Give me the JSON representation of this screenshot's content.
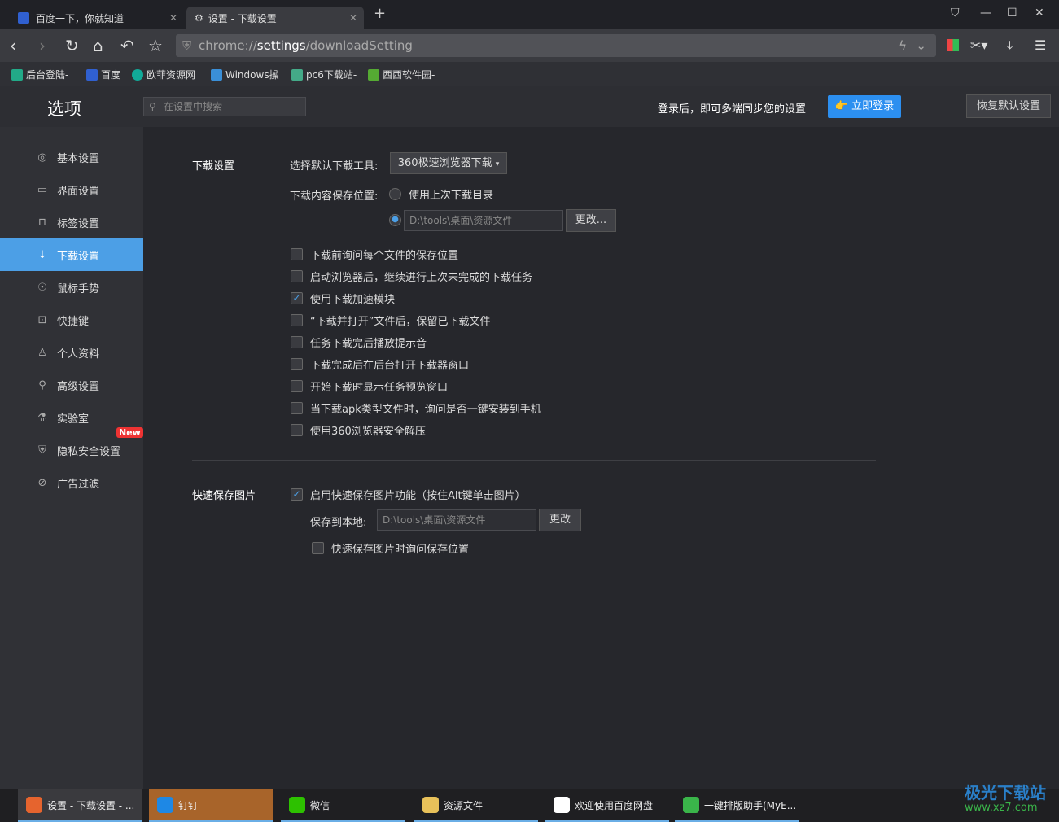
{
  "tabs": [
    {
      "label": "百度一下，你就知道"
    },
    {
      "label": "设置 - 下载设置"
    }
  ],
  "url": {
    "scheme": "chrome://",
    "host": "settings",
    "path": "/downloadSetting"
  },
  "bookmarks": [
    "后台登陆-",
    "百度",
    "欧菲资源网",
    "Windows操",
    "pc6下载站-",
    "西西软件园-"
  ],
  "header": {
    "title": "选项",
    "search_placeholder": "在设置中搜索",
    "sync_text": "登录后，即可多端同步您的设置",
    "login": "立即登录",
    "restore": "恢复默认设置"
  },
  "sidebar": {
    "items": [
      {
        "label": "基本设置",
        "icon": "◎"
      },
      {
        "label": "界面设置",
        "icon": "▭"
      },
      {
        "label": "标签设置",
        "icon": "⊓"
      },
      {
        "label": "下载设置",
        "icon": "↓"
      },
      {
        "label": "鼠标手势",
        "icon": "☉"
      },
      {
        "label": "快捷键",
        "icon": "⊡"
      },
      {
        "label": "个人资料",
        "icon": "♙"
      },
      {
        "label": "高级设置",
        "icon": "⚲"
      },
      {
        "label": "实验室",
        "icon": "⚗"
      },
      {
        "label": "隐私安全设置",
        "icon": "⛨"
      },
      {
        "label": "广告过滤",
        "icon": "⊘"
      }
    ],
    "new_badge": "New"
  },
  "download": {
    "section": "下载设置",
    "tool_label": "选择默认下载工具:",
    "tool_value": "360极速浏览器下载",
    "save_label": "下载内容保存位置:",
    "radio1": "使用上次下载目录",
    "path": "D:\\tools\\桌面\\资源文件",
    "change": "更改...",
    "options": [
      {
        "label": "下载前询问每个文件的保存位置",
        "checked": false
      },
      {
        "label": "启动浏览器后，继续进行上次未完成的下载任务",
        "checked": false
      },
      {
        "label": "使用下载加速模块",
        "checked": true
      },
      {
        "label": "“下载并打开”文件后，保留已下载文件",
        "checked": false
      },
      {
        "label": "任务下载完后播放提示音",
        "checked": false
      },
      {
        "label": "下载完成后在后台打开下载器窗口",
        "checked": false
      },
      {
        "label": "开始下载时显示任务预览窗口",
        "checked": false
      },
      {
        "label": "当下载apk类型文件时，询问是否一键安装到手机",
        "checked": false
      },
      {
        "label": "使用360浏览器安全解压",
        "checked": false
      }
    ]
  },
  "quicksave": {
    "section": "快速保存图片",
    "enable": "启用快速保存图片功能（按住Alt键单击图片）",
    "save_local": "保存到本地:",
    "path": "D:\\tools\\桌面\\资源文件",
    "change": "更改",
    "ask": "快速保存图片时询问保存位置"
  },
  "taskbar": [
    {
      "label": "设置 - 下载设置 - ...",
      "color": "#e6642e"
    },
    {
      "label": "钉钉",
      "color": "#1e88e5"
    },
    {
      "label": "微信",
      "color": "#2dc100"
    },
    {
      "label": "资源文件",
      "color": "#e8c15a"
    },
    {
      "label": "欢迎使用百度网盘",
      "color": "#ffffff"
    },
    {
      "label": "一键排版助手(MyE...",
      "color": "#3ab54a"
    }
  ],
  "watermark": {
    "name": "极光下载站",
    "url": "www.xz7.com"
  }
}
